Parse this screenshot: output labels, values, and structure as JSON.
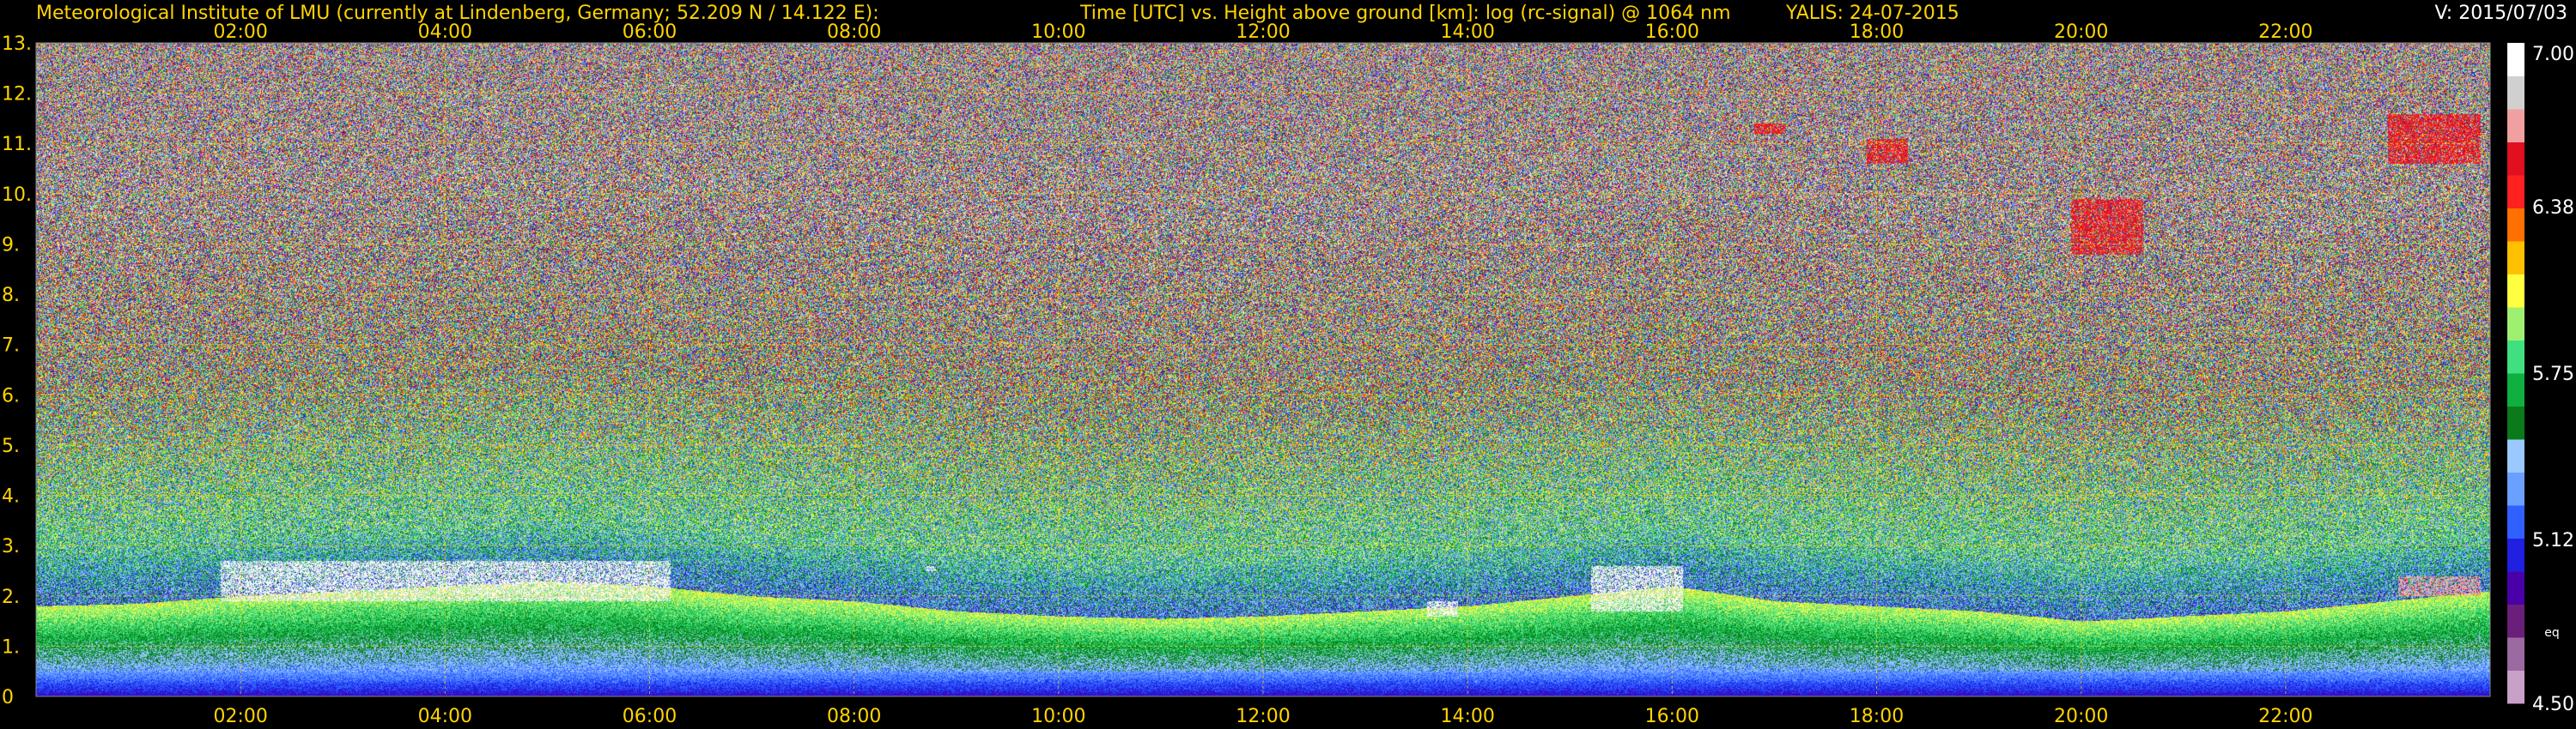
{
  "header": {
    "institute": "Meteorological Institute of LMU (currently at Lindenberg, Germany; 52.209 N / 14.122 E):",
    "plot_title": "Time [UTC] vs. Height above ground [km]: log (rc-signal) @ 1064 nm",
    "instrument_date": "YALIS: 24-07-2015",
    "version": "V: 2015/07/03"
  },
  "colorbar": {
    "ticks": [
      "7.00",
      "6.38",
      "5.75",
      "5.12",
      "4.50"
    ],
    "tick_values": [
      7.0,
      6.38,
      5.75,
      5.12,
      4.5
    ],
    "unit_note": "eq",
    "range": [
      4.5,
      7.0
    ],
    "colors": [
      "#c8a0c8",
      "#9a6aa0",
      "#6a1f7a",
      "#4a00a8",
      "#2020e0",
      "#3060ff",
      "#6aa0ff",
      "#9ac8ff",
      "#0a7a1a",
      "#10b040",
      "#40e080",
      "#a0f070",
      "#ffff40",
      "#ffc000",
      "#ff7000",
      "#ff2020",
      "#e01020",
      "#f0a0a0",
      "#d0d0d0",
      "#ffffff"
    ]
  },
  "chart_data": {
    "type": "heatmap",
    "title": "Time [UTC] vs. Height above ground [km]: log (rc-signal) @ 1064 nm",
    "xlabel": "Time [UTC]",
    "ylabel": "Height above ground [km]",
    "xlim": [
      0,
      24
    ],
    "ylim": [
      0,
      13
    ],
    "x_ticks": [
      "02:00",
      "04:00",
      "06:00",
      "08:00",
      "10:00",
      "12:00",
      "14:00",
      "16:00",
      "18:00",
      "20:00",
      "22:00"
    ],
    "x_tick_values": [
      2,
      4,
      6,
      8,
      10,
      12,
      14,
      16,
      18,
      20,
      22
    ],
    "y_ticks": [
      "0",
      "1.",
      "2.",
      "3.",
      "4.",
      "5.",
      "6.",
      "7.",
      "8.",
      "9.",
      "10.",
      "11.",
      "12.",
      "13."
    ],
    "y_tick_values": [
      0,
      1,
      2,
      3,
      4,
      5,
      6,
      7,
      8,
      9,
      10,
      11,
      12,
      13
    ],
    "grid": true,
    "colorbar_range": [
      4.5,
      7.0
    ],
    "features": {
      "boundary_layer_top_km": [
        [
          0.0,
          1.8
        ],
        [
          1.0,
          1.85
        ],
        [
          2.0,
          2.0
        ],
        [
          3.0,
          2.1
        ],
        [
          4.0,
          2.2
        ],
        [
          5.0,
          2.3
        ],
        [
          6.0,
          2.2
        ],
        [
          7.0,
          2.0
        ],
        [
          8.0,
          1.9
        ],
        [
          9.0,
          1.7
        ],
        [
          10.0,
          1.6
        ],
        [
          11.0,
          1.55
        ],
        [
          12.0,
          1.6
        ],
        [
          13.0,
          1.7
        ],
        [
          14.0,
          1.8
        ],
        [
          15.0,
          2.0
        ],
        [
          16.0,
          2.2
        ],
        [
          17.0,
          1.9
        ],
        [
          18.0,
          1.8
        ],
        [
          19.0,
          1.7
        ],
        [
          20.0,
          1.5
        ],
        [
          21.0,
          1.6
        ],
        [
          22.0,
          1.7
        ],
        [
          23.0,
          1.9
        ],
        [
          24.0,
          2.1
        ]
      ],
      "clouds": [
        {
          "t0": 1.8,
          "t1": 6.2,
          "h0": 1.9,
          "h1": 2.7,
          "level": 7.0
        },
        {
          "t0": 8.7,
          "t1": 8.8,
          "h0": 2.5,
          "h1": 2.6,
          "level": 7.0
        },
        {
          "t0": 13.6,
          "t1": 13.9,
          "h0": 1.6,
          "h1": 1.9,
          "level": 7.0
        },
        {
          "t0": 15.2,
          "t1": 16.1,
          "h0": 1.7,
          "h1": 2.6,
          "level": 7.0
        },
        {
          "t0": 23.1,
          "t1": 23.9,
          "h0": 2.0,
          "h1": 2.4,
          "level": 6.8
        },
        {
          "t0": 16.8,
          "t1": 17.1,
          "h0": 11.2,
          "h1": 11.4,
          "level": 6.6
        },
        {
          "t0": 17.9,
          "t1": 18.3,
          "h0": 10.6,
          "h1": 11.1,
          "level": 6.6
        },
        {
          "t0": 19.9,
          "t1": 20.6,
          "h0": 8.8,
          "h1": 9.9,
          "level": 6.6
        },
        {
          "t0": 23.0,
          "t1": 23.9,
          "h0": 10.6,
          "h1": 11.6,
          "level": 6.6
        }
      ]
    }
  }
}
